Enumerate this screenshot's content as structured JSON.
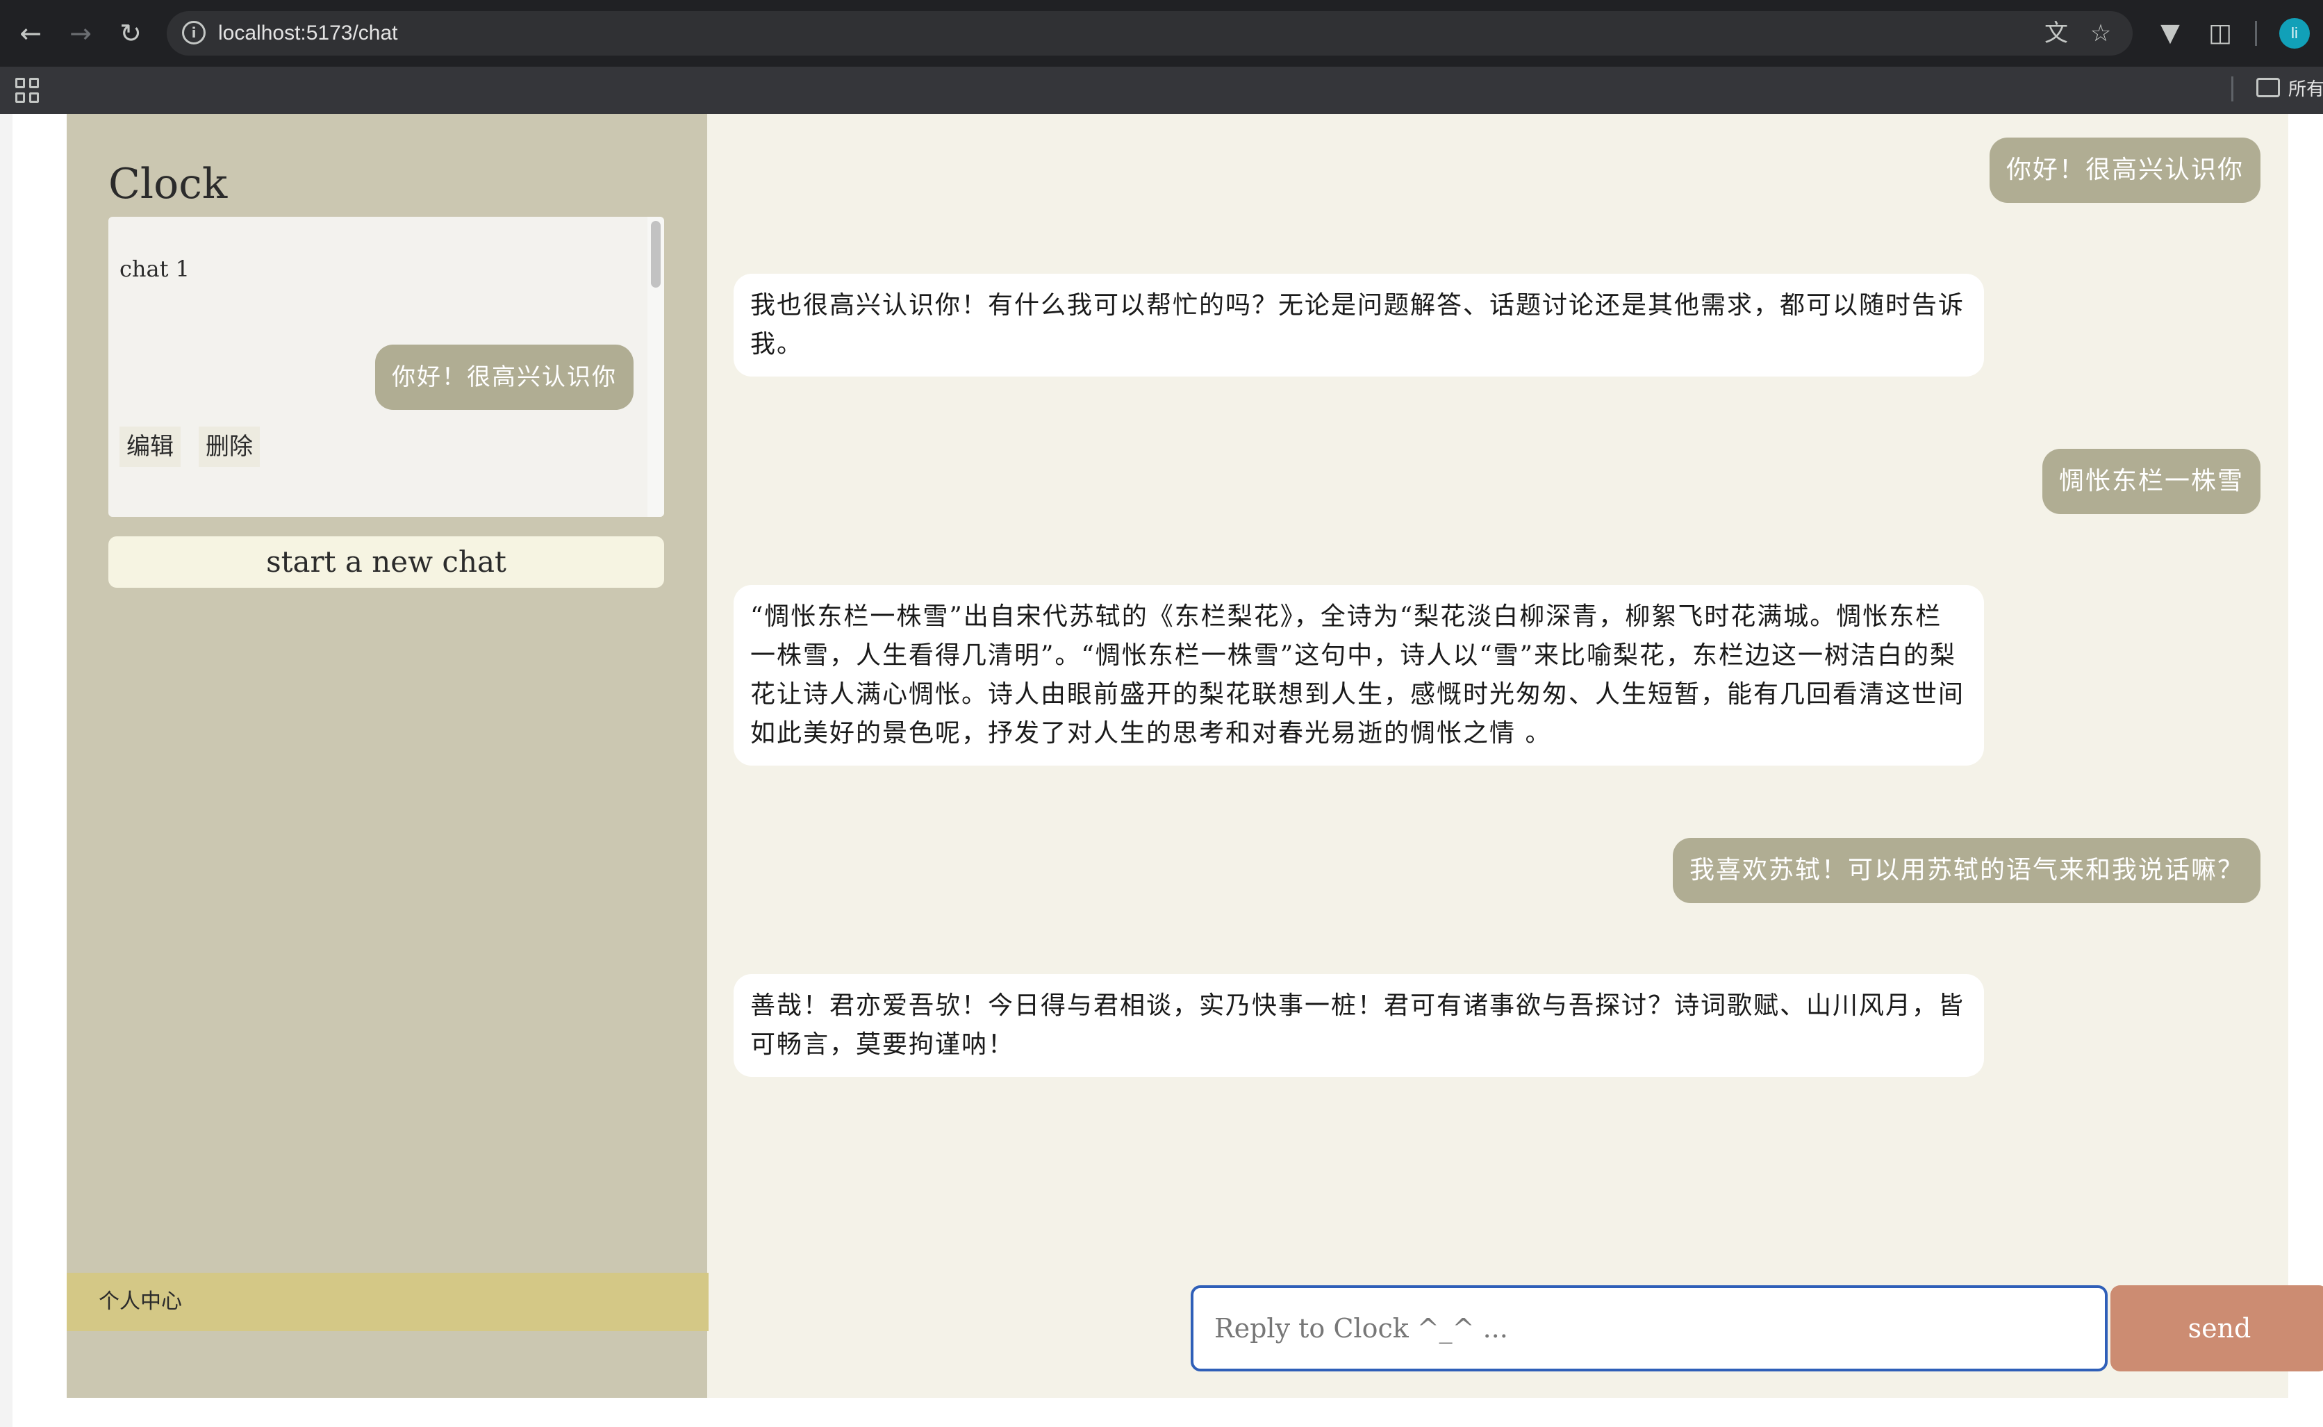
{
  "browser": {
    "url": "localhost:5173/chat",
    "bookmarks_label": "所有"
  },
  "sidebar": {
    "title": "Clock",
    "chats": [
      {
        "title": "chat 1",
        "preview": "你好！很高兴认识你",
        "edit_label": "编辑",
        "delete_label": "删除"
      }
    ],
    "new_chat_label": "start a new chat",
    "profile_label": "个人中心"
  },
  "messages": [
    {
      "role": "user",
      "text": "你好！很高兴认识你"
    },
    {
      "role": "bot",
      "text": "我也很高兴认识你！有什么我可以帮忙的吗？无论是问题解答、话题讨论还是其他需求，都可以随时告诉我。"
    },
    {
      "role": "user",
      "text": "惆怅东栏一株雪"
    },
    {
      "role": "bot",
      "text": "“惆怅东栏一株雪”出自宋代苏轼的《东栏梨花》，全诗为“梨花淡白柳深青，柳絮飞时花满城。惆怅东栏一株雪，人生看得几清明”。“惆怅东栏一株雪”这句中，诗人以“雪”来比喻梨花，东栏边这一树洁白的梨花让诗人满心惆怅。诗人由眼前盛开的梨花联想到人生，感慨时光匆匆、人生短暂，能有几回看清这世间如此美好的景色呢，抒发了对人生的思考和对春光易逝的惆怅之情 。"
    },
    {
      "role": "user",
      "text": "我喜欢苏轼！可以用苏轼的语气来和我说话嘛？"
    },
    {
      "role": "bot",
      "text": "善哉！君亦爱吾欤！今日得与君相谈，实乃快事一桩！君可有诸事欲与吾探讨？诗词歌赋、山川风月，皆可畅言，莫要拘谨呐！"
    }
  ],
  "composer": {
    "placeholder": "Reply to Clock ^_^ ...",
    "send_label": "send"
  },
  "colors": {
    "sidebar_bg": "#cbc7b1",
    "chat_bg": "#f4f2e8",
    "user_bubble": "#b0ad93",
    "send_button": "#cc8c72",
    "profile_bar": "#d4c886"
  }
}
